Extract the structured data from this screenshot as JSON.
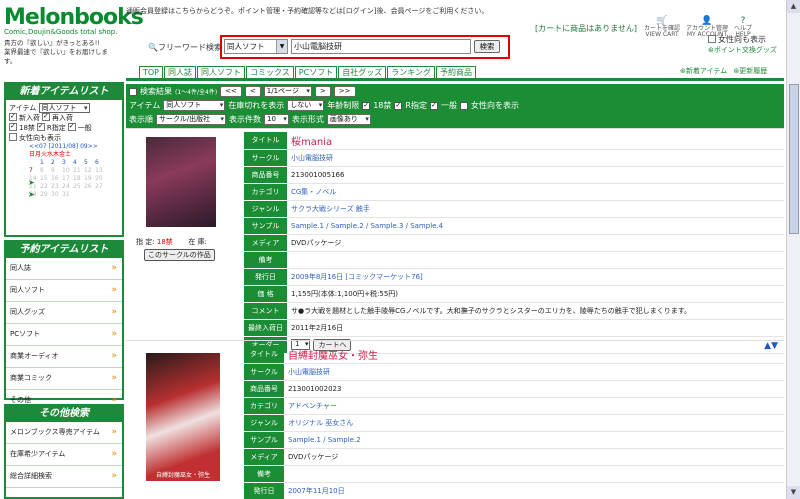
{
  "header": {
    "logo": "Melonbooks",
    "logo_sub": "Comic,Doujin&Goods total shop.",
    "logo_tagline": "貴方の『欲しい』がきっとある!!\n業界最速で『欲しい』をお届けします。",
    "notice": "通販会員登録はこちらからどうぞ。ポイント管理・予約確認等などは[ログイン]後、会員ページをご利用ください。",
    "cart_message": "[カートに商品はありません]",
    "icons": [
      {
        "label": "カートを確認\nVIEW CART",
        "icon": "cart-icon"
      },
      {
        "label": "アカウント管理\nMY ACCOUNT",
        "icon": "account-icon"
      },
      {
        "label": "ヘルプ\nHELP",
        "icon": "help-icon"
      }
    ],
    "female_label": "女性向も表示",
    "point_exchange": "ポイント交換グッズ",
    "new_items": "新着アイテム",
    "update_history": "更新履歴"
  },
  "search": {
    "label": "フリーワード検索",
    "category": "同人ソフト",
    "query": "小山電脳技研",
    "button": "検索"
  },
  "tabs": [
    "TOP",
    "同人誌",
    "同人ソフト",
    "コミックス",
    "PCソフト",
    "自社グッズ",
    "ランキング",
    "予約商品"
  ],
  "sidebar": {
    "new_title": "新着アイテムリスト",
    "item_label": "アイテム",
    "item_value": "同人ソフト",
    "checks": [
      {
        "label": "新入荷",
        "on": true
      },
      {
        "label": "再入荷",
        "on": true
      },
      {
        "label": "18禁",
        "on": true
      },
      {
        "label": "R指定",
        "on": true
      },
      {
        "label": "一般",
        "on": true
      },
      {
        "label": "女性向も表示",
        "on": false
      }
    ],
    "cal_header": "<<07 [2011/08] 09>>",
    "cal_days": "日月火水木金土",
    "cal_rows": [
      [
        "",
        "1",
        "2",
        "3",
        "4",
        "5",
        "6"
      ],
      [
        "7",
        "8",
        "9",
        "10",
        "11",
        "12",
        "13"
      ],
      [
        "14",
        "15",
        "16",
        "17",
        "18",
        "19",
        "20"
      ],
      [
        "21",
        "22",
        "23",
        "24",
        "25",
        "26",
        "27"
      ],
      [
        "28",
        "29",
        "30",
        "31",
        "",
        "",
        ""
      ]
    ],
    "reserve_title": "予約アイテムリスト",
    "reserve_items": [
      "同人誌",
      "同人ソフト",
      "同人グッズ",
      "PCソフト",
      "商業オーディオ",
      "商業コミック",
      "その他"
    ],
    "other_title": "その他検索",
    "other_items": [
      "メロンブックス専売アイテム",
      "在庫希少アイテム",
      "総合詳細検索"
    ]
  },
  "filter": {
    "result_label": "検索結果",
    "result_count": "(1〜4件/全4件)",
    "nav": [
      "<<",
      "<",
      "1/1ページ",
      ">",
      ">>"
    ],
    "item_label": "アイテム",
    "item_value": "同人ソフト",
    "out_label": "在庫切れを表示",
    "out_value": "しない",
    "age_label": "年齢制限",
    "age_checks": [
      "18禁",
      "R指定",
      "一般",
      "女性向を表示"
    ],
    "order_label": "表示順",
    "order_value": "サークル/出版社",
    "count_label": "表示件数",
    "count_value": "10",
    "format_label": "表示形式",
    "format_value": "画像あり"
  },
  "products": [
    {
      "designation_label": "指  定:",
      "designation": "18禁",
      "stock_label": "在  庫:",
      "circle_button": "このサークルの作品",
      "rows": [
        {
          "k": "タイトル",
          "v": "桜mania",
          "type": "title"
        },
        {
          "k": "サークル",
          "v": "小山電脳技研",
          "type": "blue"
        },
        {
          "k": "商品番号",
          "v": "213001005166"
        },
        {
          "k": "カテゴリ",
          "v": "CG集・ノベル",
          "type": "blue"
        },
        {
          "k": "ジャンル",
          "v": "サクラ大戦シリーズ  触手",
          "type": "blue"
        },
        {
          "k": "サンプル",
          "v": "Sample.1 / Sample.2 / Sample.3 / Sample.4",
          "type": "blue"
        },
        {
          "k": "メディア",
          "v": "DVDパッケージ"
        },
        {
          "k": "備考",
          "v": ""
        },
        {
          "k": "発行日",
          "v": "2009年8月16日 [コミックマーケット76]",
          "type": "blue"
        },
        {
          "k": "価 格",
          "v": "1,155円(本体:1,100円+税:55円)"
        },
        {
          "k": "コメント",
          "v": "サ●ラ大戦を題材とした触手陵辱CGノベルです。大和撫子のサクラとシスターのエリカを、陵辱たちの触手で犯しまくります。"
        },
        {
          "k": "最終入荷日",
          "v": "2011年2月16日"
        }
      ],
      "order_label": "オーダー",
      "order_qty": "1",
      "cart_button": "カートへ"
    },
    {
      "cover_text": "自縛封魔巫女・弥生",
      "rows": [
        {
          "k": "タイトル",
          "v": "自縛封魔巫女・弥生",
          "type": "title"
        },
        {
          "k": "サークル",
          "v": "小山電脳技研",
          "type": "blue"
        },
        {
          "k": "商品番号",
          "v": "213001002023"
        },
        {
          "k": "カテゴリ",
          "v": "アドベンチャー",
          "type": "blue"
        },
        {
          "k": "ジャンル",
          "v": "オリジナル  巫女さん",
          "type": "blue"
        },
        {
          "k": "サンプル",
          "v": "Sample.1 / Sample.2",
          "type": "blue"
        },
        {
          "k": "メディア",
          "v": "DVDパッケージ"
        },
        {
          "k": "備考",
          "v": ""
        },
        {
          "k": "発行日",
          "v": "2007年11月10日",
          "type": "blue"
        }
      ]
    }
  ]
}
